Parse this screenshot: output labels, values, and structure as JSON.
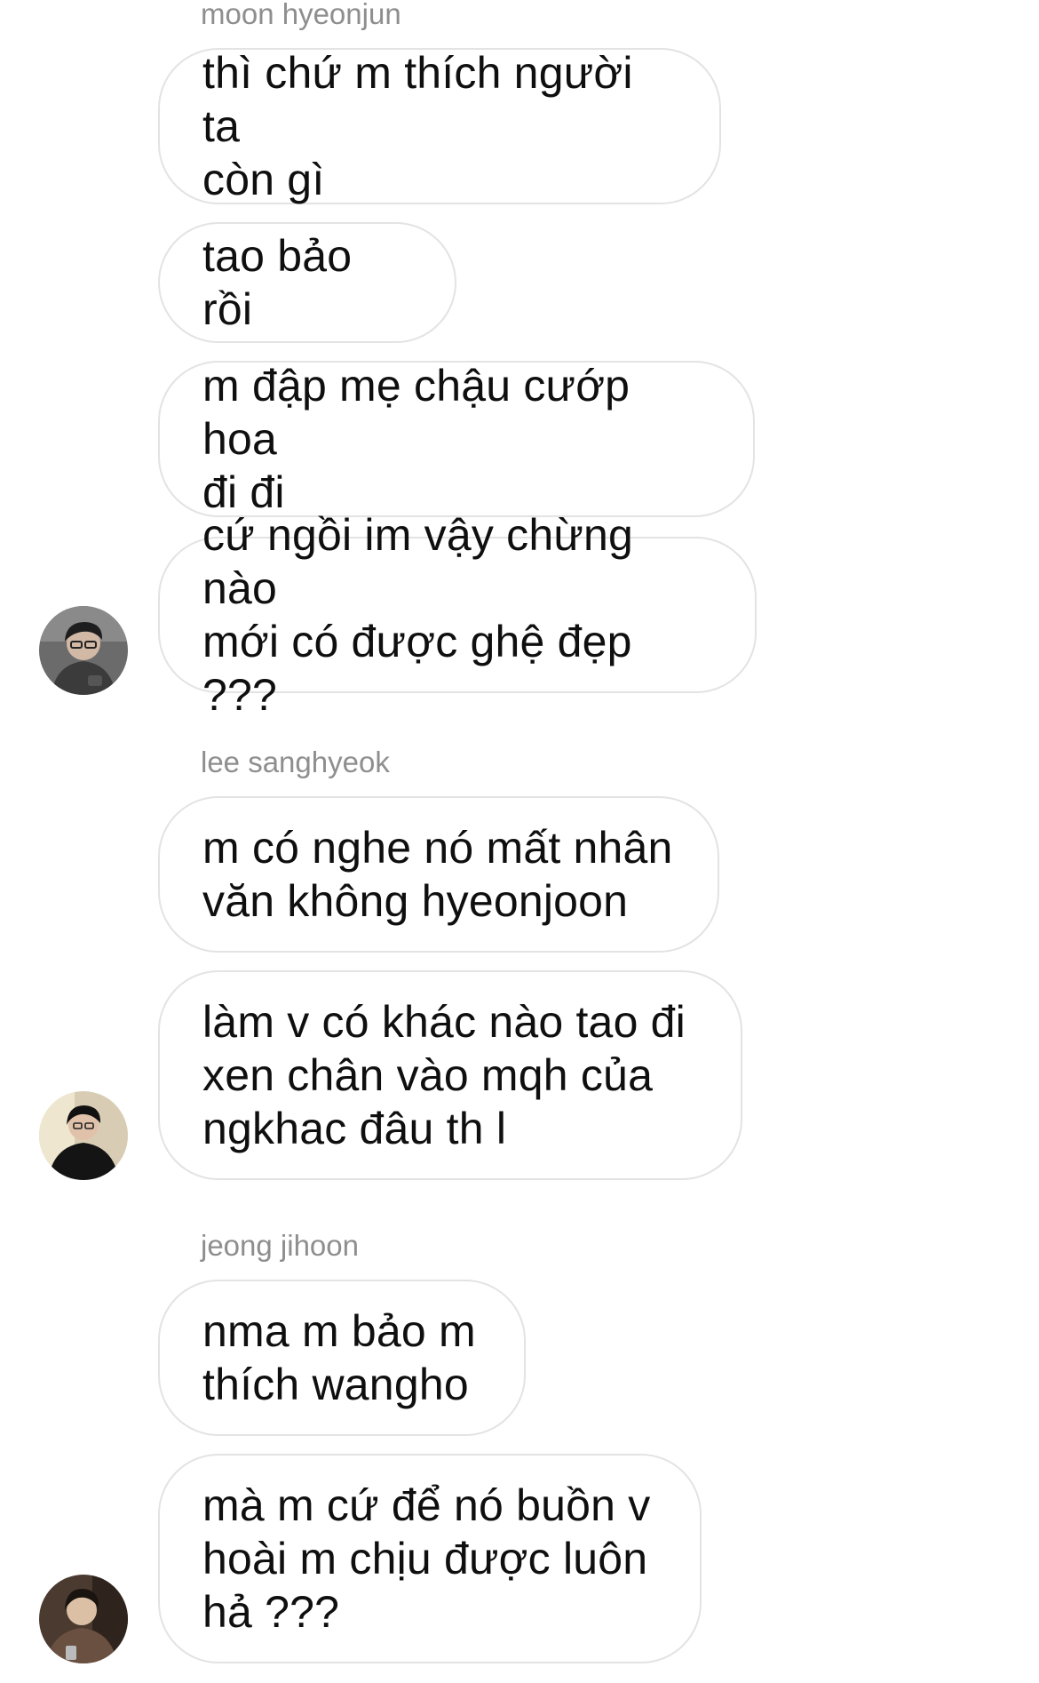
{
  "thread": {
    "groups": [
      {
        "sender": "moon hyeonjun",
        "avatar_icon": "profile-photo-icon",
        "messages": [
          "thì chứ m thích người ta\ncòn gì",
          "tao bảo rồi",
          "m đập mẹ chậu cướp hoa\nđi đi",
          "cứ ngồi im vậy chừng nào\nmới có được ghệ đẹp ???"
        ]
      },
      {
        "sender": "lee sanghyeok",
        "avatar_icon": "profile-photo-icon",
        "messages": [
          "m có nghe nó mất nhân\nvăn không hyeonjoon",
          "làm v có khác nào tao đi\nxen chân vào mqh của\nngkhac đâu th l"
        ]
      },
      {
        "sender": "jeong jihoon",
        "avatar_icon": "profile-photo-icon",
        "messages": [
          "nma m bảo m\nthích wangho",
          "mà m cứ để nó buồn v\nhoài m chịu được luôn\nhả ???"
        ]
      }
    ]
  }
}
